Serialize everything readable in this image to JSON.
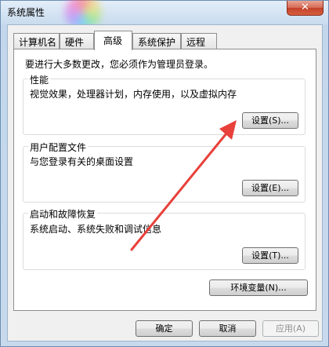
{
  "window": {
    "title": "系统属性",
    "close_glyph": "✕"
  },
  "tabs": [
    {
      "label": "计算机名"
    },
    {
      "label": "硬件"
    },
    {
      "label": "高级",
      "active": true
    },
    {
      "label": "系统保护"
    },
    {
      "label": "远程"
    }
  ],
  "main": {
    "admin_notice": "要进行大多数更改，您必须作为管理员登录。",
    "performance": {
      "title": "性能",
      "desc": "视觉效果，处理器计划，内存使用，以及虚拟内存",
      "button": "设置(S)..."
    },
    "user_profiles": {
      "title": "用户配置文件",
      "desc": "与您登录有关的桌面设置",
      "button": "设置(E)..."
    },
    "startup_recovery": {
      "title": "启动和故障恢复",
      "desc": "系统启动、系统失败和调试信息",
      "button": "设置(T)..."
    },
    "env_button": "环境变量(N)..."
  },
  "footer": {
    "ok": "确定",
    "cancel": "取消",
    "apply": "应用(A)"
  },
  "colors": {
    "annotation_arrow": "#e8403a",
    "close_button": "#c4412a"
  },
  "icons": {
    "close": "close-icon",
    "arrow": "annotation-arrow"
  }
}
